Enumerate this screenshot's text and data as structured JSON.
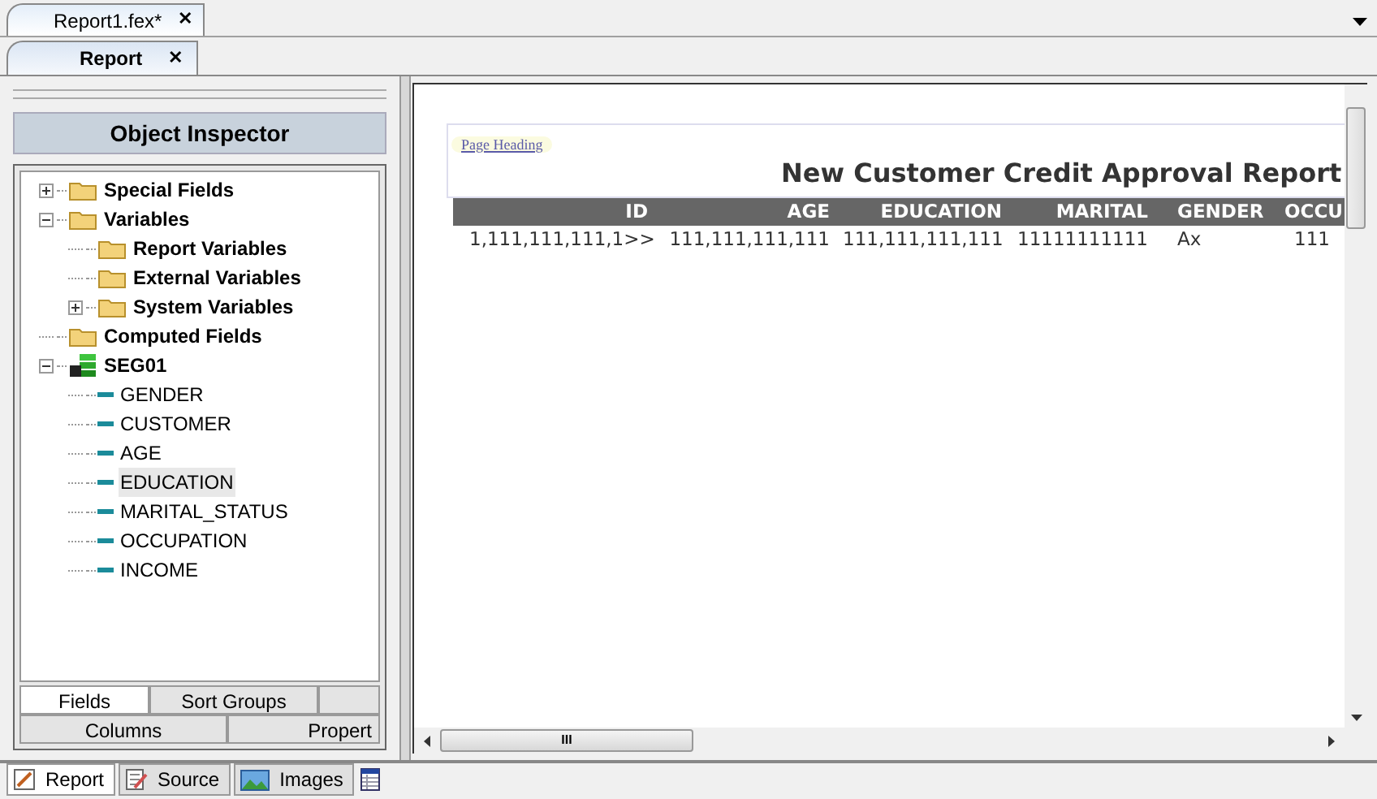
{
  "document_tabs": [
    {
      "label": "Report1.fex*",
      "selected": true,
      "close": "✕"
    }
  ],
  "view_tabs": [
    {
      "label": "Report",
      "selected": true,
      "close": "✕"
    }
  ],
  "inspector": {
    "title": "Object Inspector",
    "tree": [
      {
        "label": "Special Fields",
        "kind": "folder",
        "expanded": false,
        "selected": false
      },
      {
        "label": "Variables",
        "kind": "folder",
        "expanded": true,
        "selected": false,
        "children": [
          {
            "label": "Report Variables",
            "kind": "folder",
            "selected": false
          },
          {
            "label": "External Variables",
            "kind": "folder",
            "selected": false
          },
          {
            "label": "System Variables",
            "kind": "folder",
            "expanded": false,
            "selected": false
          }
        ]
      },
      {
        "label": "Computed Fields",
        "kind": "folder",
        "selected": false
      },
      {
        "label": "SEG01",
        "kind": "segment",
        "expanded": true,
        "selected": false,
        "children": [
          {
            "label": "GENDER",
            "kind": "field",
            "selected": false
          },
          {
            "label": "CUSTOMER",
            "kind": "field",
            "selected": false
          },
          {
            "label": "AGE",
            "kind": "field",
            "selected": false
          },
          {
            "label": "EDUCATION",
            "kind": "field",
            "selected": true
          },
          {
            "label": "MARITAL_STATUS",
            "kind": "field",
            "selected": false
          },
          {
            "label": "OCCUPATION",
            "kind": "field",
            "selected": false
          },
          {
            "label": "INCOME",
            "kind": "field",
            "selected": false
          }
        ]
      }
    ],
    "tab_rows": [
      [
        {
          "label": "Fields",
          "selected": true
        },
        {
          "label": "Sort Groups",
          "selected": false
        },
        {
          "selected": false
        }
      ],
      [
        {
          "label": "Columns",
          "selected": false
        },
        {
          "label": "Propert",
          "selected": false
        }
      ]
    ]
  },
  "report": {
    "heading_badge": "Page Heading",
    "title": "New Customer Credit Approval Report",
    "columns": [
      "ID",
      "AGE",
      "EDUCATION",
      "MARITAL",
      "GENDER",
      "OCCU"
    ],
    "rows": [
      [
        "1,111,111,111,1>>",
        "111,111,111,111",
        "111,111,111,111",
        "11111111111",
        "Ax",
        "111"
      ]
    ]
  },
  "scrollbar_grip": "III",
  "bottom_tabs": [
    {
      "label": "Report",
      "kind": "report",
      "selected": true
    },
    {
      "label": "Source",
      "kind": "source",
      "selected": false
    },
    {
      "label": "Images",
      "kind": "images",
      "selected": false
    },
    {
      "kind": "table",
      "selected": false
    }
  ]
}
